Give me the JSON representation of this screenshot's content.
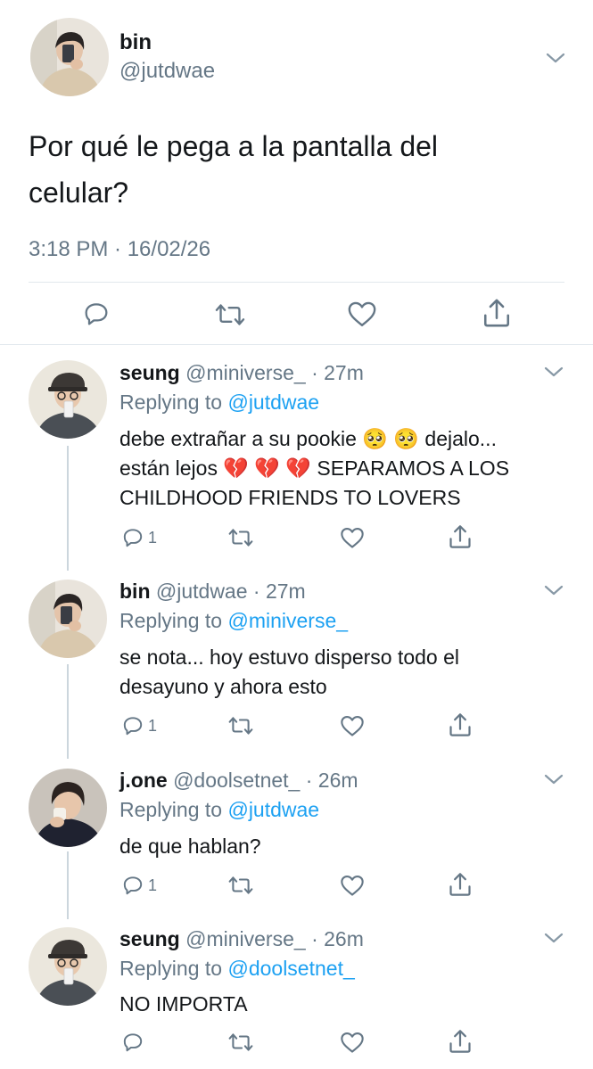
{
  "main_tweet": {
    "name": "bin",
    "handle": "@jutdwae",
    "text": "Por qué le pega a la pantalla del celular?",
    "timestamp": "3:18 PM · 16/02/26",
    "actions": [
      "reply-icon",
      "retweet-icon",
      "like-icon",
      "share-icon"
    ]
  },
  "replies": [
    {
      "name": "seung",
      "handle": "@miniverse_",
      "time": "· 27m",
      "replying_prefix": "Replying to",
      "replying_to": "@jutdwae",
      "line1": "debe extrañar a su pookie 🥺 🥺  dejalo...",
      "line2": "están lejos 💔 💔 💔  SEPARAMOS A LOS",
      "line3": "CHILDHOOD FRIENDS TO LOVERS",
      "reply_count": "1"
    },
    {
      "name": "bin",
      "handle": "@jutdwae",
      "time": "· 27m",
      "replying_prefix": "Replying to",
      "replying_to": "@miniverse_",
      "line1": "se nota... hoy estuvo disperso todo el",
      "line2": "desayuno y ahora esto",
      "reply_count": "1"
    },
    {
      "name": "j.one",
      "handle": "@doolsetnet_",
      "time": "· 26m",
      "replying_prefix": "Replying to",
      "replying_to": "@jutdwae",
      "line1": "de que hablan?",
      "reply_count": "1"
    },
    {
      "name": "seung",
      "handle": "@miniverse_",
      "time": "· 26m",
      "replying_prefix": "Replying to",
      "replying_to": "@doolsetnet_",
      "line1": "NO IMPORTA",
      "reply_count": ""
    }
  ],
  "colors": {
    "link": "#1da1f2",
    "muted": "#657786",
    "text": "#14171a",
    "line": "#ccd6dd"
  }
}
